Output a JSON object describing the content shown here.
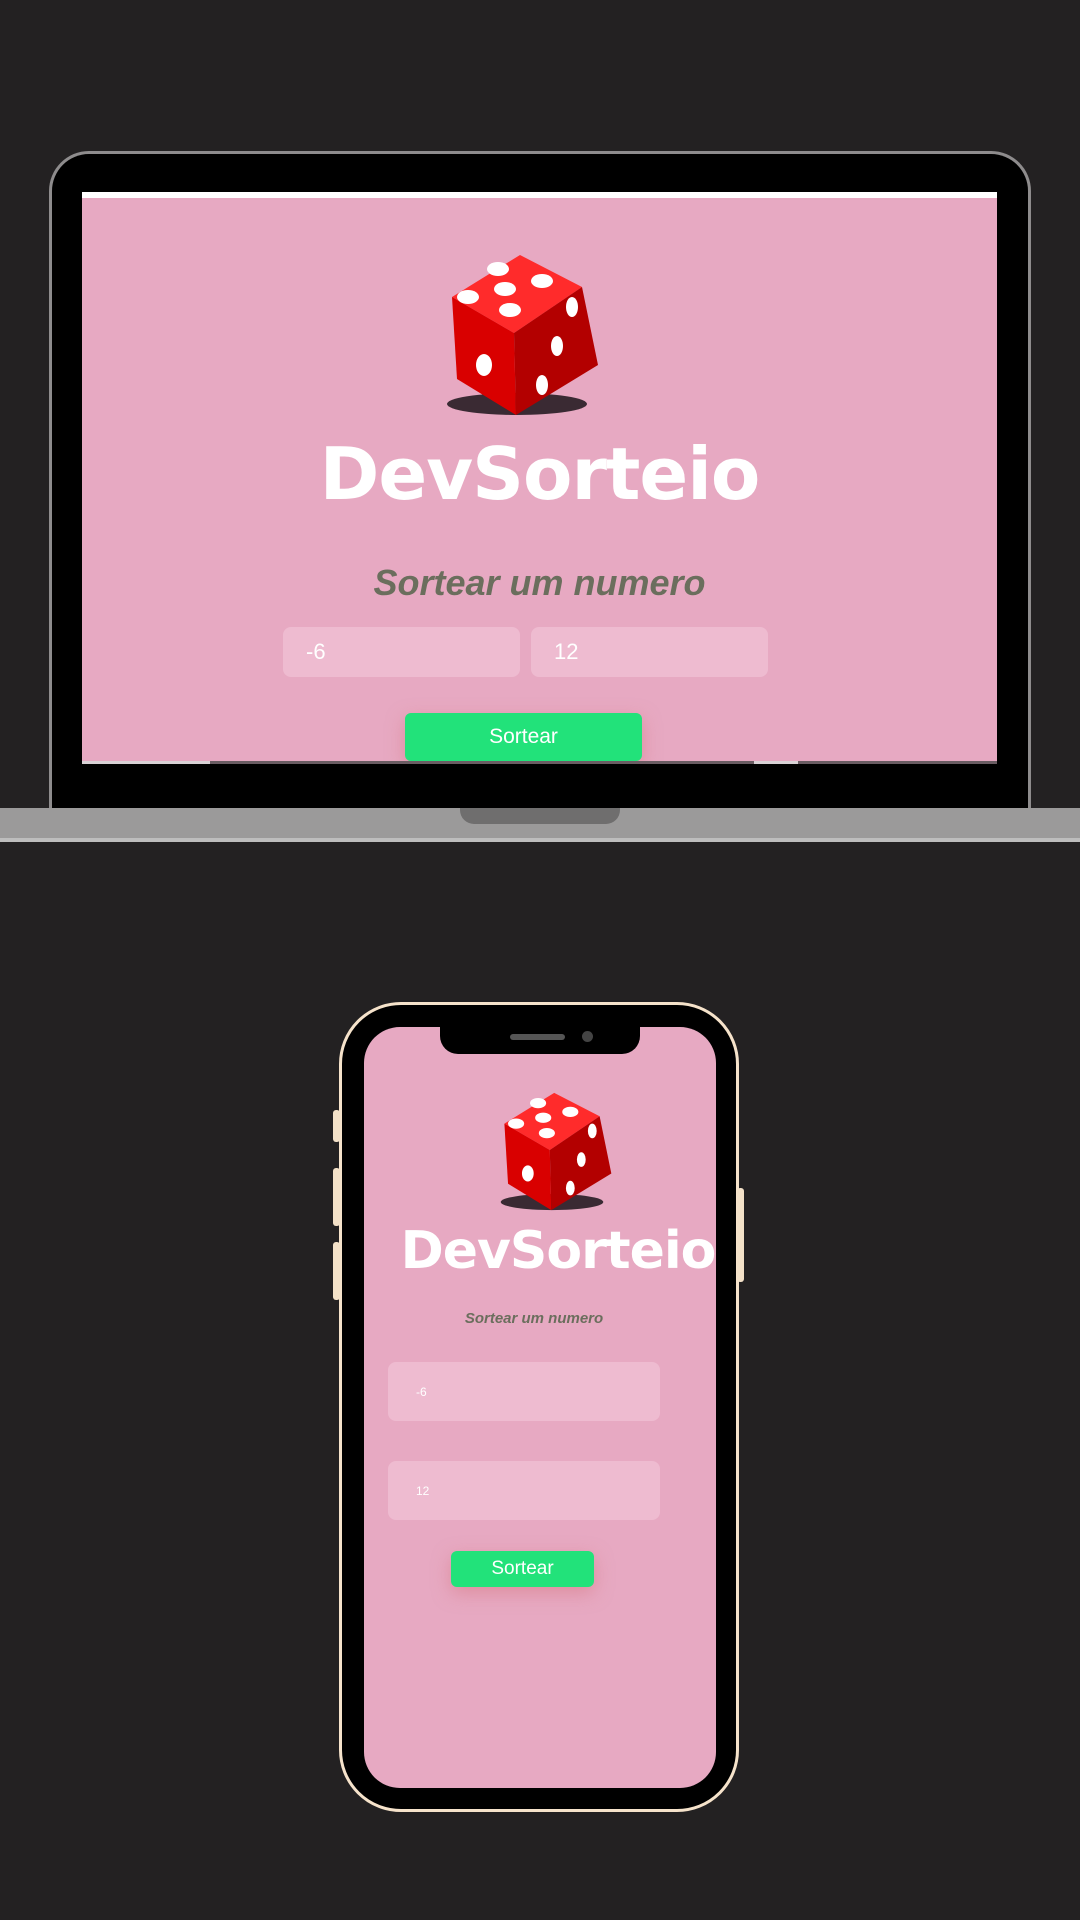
{
  "app": {
    "title": "DevSorteio",
    "subtitle": "Sortear um numero",
    "min_value": "-6",
    "max_value": "12",
    "draw_label": "Sortear"
  },
  "colors": {
    "page_background": "#232122",
    "app_background": "#e7a9c2",
    "input_background": "#eebbd0",
    "button": "#22e27a",
    "subtitle": "#6b6e5d",
    "dice": "#e00000"
  },
  "icons": {
    "dice": "dice-icon"
  }
}
